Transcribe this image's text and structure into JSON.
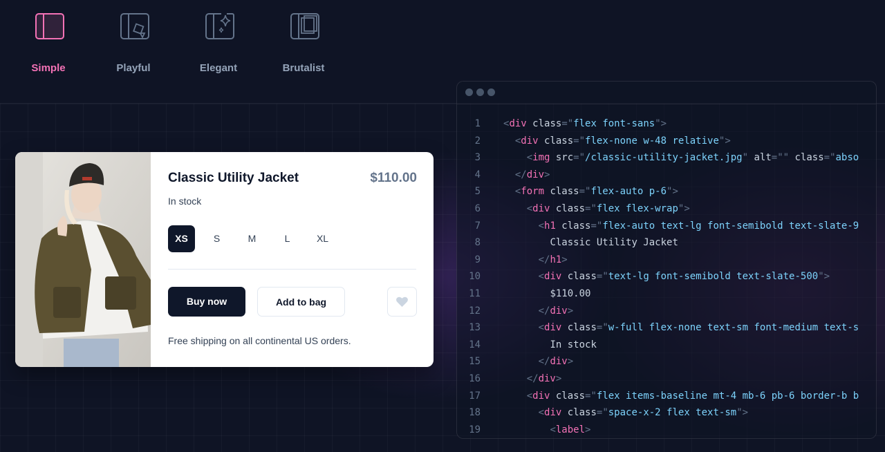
{
  "tabs": [
    {
      "label": "Simple",
      "icon": "layout-sidebar-icon",
      "active": true
    },
    {
      "label": "Playful",
      "icon": "shapes-icon",
      "active": false
    },
    {
      "label": "Elegant",
      "icon": "sparkle-icon",
      "active": false
    },
    {
      "label": "Brutalist",
      "icon": "stacked-squares-icon",
      "active": false
    }
  ],
  "product": {
    "title": "Classic Utility Jacket",
    "price": "$110.00",
    "stock": "In stock",
    "sizes": [
      "XS",
      "S",
      "M",
      "L",
      "XL"
    ],
    "selected_size": "XS",
    "buy_label": "Buy now",
    "bag_label": "Add to bag",
    "shipping": "Free shipping on all continental US orders."
  },
  "code_lines": [
    {
      "n": "1",
      "indent": 0,
      "parts": [
        [
          "p",
          "<"
        ],
        [
          "t",
          "div"
        ],
        [
          "a",
          " class"
        ],
        [
          "p",
          "=\""
        ],
        [
          "s",
          "flex font-sans"
        ],
        [
          "p",
          "\">"
        ]
      ]
    },
    {
      "n": "2",
      "indent": 1,
      "parts": [
        [
          "p",
          "<"
        ],
        [
          "t",
          "div"
        ],
        [
          "a",
          " class"
        ],
        [
          "p",
          "=\""
        ],
        [
          "s",
          "flex-none w-48 relative"
        ],
        [
          "p",
          "\">"
        ]
      ]
    },
    {
      "n": "3",
      "indent": 2,
      "parts": [
        [
          "p",
          "<"
        ],
        [
          "t",
          "img"
        ],
        [
          "a",
          " src"
        ],
        [
          "p",
          "=\""
        ],
        [
          "s",
          "/classic-utility-jacket.jpg"
        ],
        [
          "p",
          "\""
        ],
        [
          "a",
          " alt"
        ],
        [
          "p",
          "=\"\""
        ],
        [
          "a",
          " class"
        ],
        [
          "p",
          "=\""
        ],
        [
          "s",
          "abso"
        ]
      ]
    },
    {
      "n": "4",
      "indent": 1,
      "parts": [
        [
          "p",
          "</"
        ],
        [
          "t",
          "div"
        ],
        [
          "p",
          ">"
        ]
      ]
    },
    {
      "n": "5",
      "indent": 1,
      "parts": [
        [
          "p",
          "<"
        ],
        [
          "t",
          "form"
        ],
        [
          "a",
          " class"
        ],
        [
          "p",
          "=\""
        ],
        [
          "s",
          "flex-auto p-6"
        ],
        [
          "p",
          "\">"
        ]
      ]
    },
    {
      "n": "6",
      "indent": 2,
      "parts": [
        [
          "p",
          "<"
        ],
        [
          "t",
          "div"
        ],
        [
          "a",
          " class"
        ],
        [
          "p",
          "=\""
        ],
        [
          "s",
          "flex flex-wrap"
        ],
        [
          "p",
          "\">"
        ]
      ]
    },
    {
      "n": "7",
      "indent": 3,
      "parts": [
        [
          "p",
          "<"
        ],
        [
          "t",
          "h1"
        ],
        [
          "a",
          " class"
        ],
        [
          "p",
          "=\""
        ],
        [
          "s",
          "flex-auto text-lg font-semibold text-slate-9"
        ]
      ]
    },
    {
      "n": "8",
      "indent": 4,
      "parts": [
        [
          "a",
          "Classic Utility Jacket"
        ]
      ]
    },
    {
      "n": "9",
      "indent": 3,
      "parts": [
        [
          "p",
          "</"
        ],
        [
          "t",
          "h1"
        ],
        [
          "p",
          ">"
        ]
      ]
    },
    {
      "n": "10",
      "indent": 3,
      "parts": [
        [
          "p",
          "<"
        ],
        [
          "t",
          "div"
        ],
        [
          "a",
          " class"
        ],
        [
          "p",
          "=\""
        ],
        [
          "s",
          "text-lg font-semibold text-slate-500"
        ],
        [
          "p",
          "\">"
        ]
      ]
    },
    {
      "n": "11",
      "indent": 4,
      "parts": [
        [
          "a",
          "$110.00"
        ]
      ]
    },
    {
      "n": "12",
      "indent": 3,
      "parts": [
        [
          "p",
          "</"
        ],
        [
          "t",
          "div"
        ],
        [
          "p",
          ">"
        ]
      ]
    },
    {
      "n": "13",
      "indent": 3,
      "parts": [
        [
          "p",
          "<"
        ],
        [
          "t",
          "div"
        ],
        [
          "a",
          " class"
        ],
        [
          "p",
          "=\""
        ],
        [
          "s",
          "w-full flex-none text-sm font-medium text-s"
        ]
      ]
    },
    {
      "n": "14",
      "indent": 4,
      "parts": [
        [
          "a",
          "In stock"
        ]
      ]
    },
    {
      "n": "15",
      "indent": 3,
      "parts": [
        [
          "p",
          "</"
        ],
        [
          "t",
          "div"
        ],
        [
          "p",
          ">"
        ]
      ]
    },
    {
      "n": "16",
      "indent": 2,
      "parts": [
        [
          "p",
          "</"
        ],
        [
          "t",
          "div"
        ],
        [
          "p",
          ">"
        ]
      ]
    },
    {
      "n": "17",
      "indent": 2,
      "parts": [
        [
          "p",
          "<"
        ],
        [
          "t",
          "div"
        ],
        [
          "a",
          " class"
        ],
        [
          "p",
          "=\""
        ],
        [
          "s",
          "flex items-baseline mt-4 mb-6 pb-6 border-b b"
        ]
      ]
    },
    {
      "n": "18",
      "indent": 3,
      "parts": [
        [
          "p",
          "<"
        ],
        [
          "t",
          "div"
        ],
        [
          "a",
          " class"
        ],
        [
          "p",
          "=\""
        ],
        [
          "s",
          "space-x-2 flex text-sm"
        ],
        [
          "p",
          "\">"
        ]
      ]
    },
    {
      "n": "19",
      "indent": 4,
      "parts": [
        [
          "p",
          "<"
        ],
        [
          "t",
          "label"
        ],
        [
          "p",
          ">"
        ]
      ]
    }
  ],
  "colors": {
    "accent": "#f472b6",
    "primary_button": "#0f172a",
    "background": "#0f1425"
  }
}
